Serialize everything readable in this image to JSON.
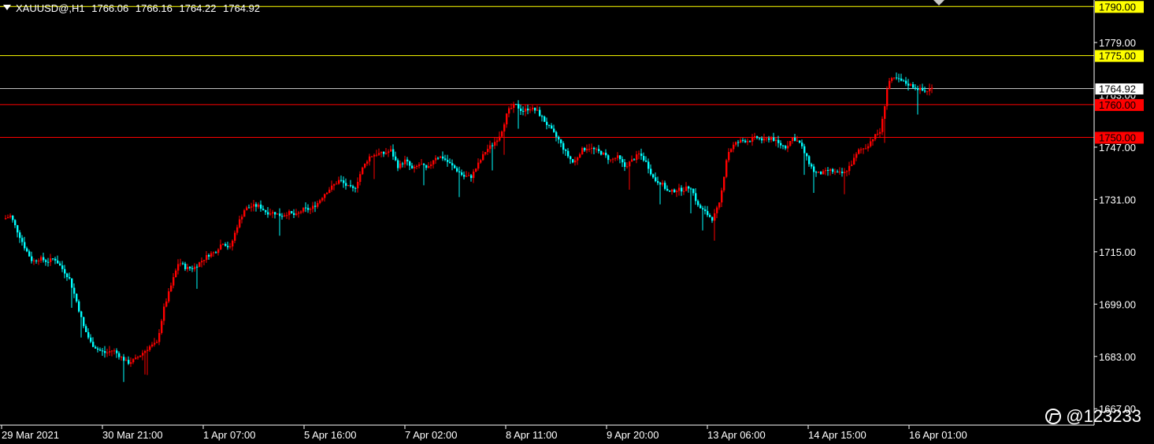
{
  "header": {
    "symbol": "XAUUSD@,H1",
    "open": "1766.06",
    "high": "1766.16",
    "low": "1764.22",
    "close": "1764.92"
  },
  "watermark": "@123233",
  "chart_data": {
    "type": "candlestick",
    "symbol": "XAUUSD@",
    "timeframe": "H1",
    "y_ticks": [
      "1779.00",
      "1763.00",
      "1747.00",
      "1731.00",
      "1715.00",
      "1699.00",
      "1683.00",
      "1667.00"
    ],
    "x_ticks": [
      "29 Mar 2021",
      "30 Mar 21:00",
      "1 Apr 07:00",
      "5 Apr 16:00",
      "7 Apr 02:00",
      "8 Apr 11:00",
      "9 Apr 20:00",
      "13 Apr 06:00",
      "14 Apr 15:00",
      "16 Apr 01:00"
    ],
    "ylim": [
      1662,
      1792
    ],
    "current_price": {
      "label": "1764.92",
      "value": 1764.92,
      "color": "#ffffff"
    },
    "levels": [
      {
        "label": "1790.00",
        "value": 1790,
        "color": "#ffff00",
        "text_color": "#000000"
      },
      {
        "label": "1775.00",
        "value": 1775,
        "color": "#ffff00",
        "text_color": "#000000"
      },
      {
        "label": "1760.00",
        "value": 1760,
        "color": "#ff0000",
        "text_color": "#000000"
      },
      {
        "label": "1750.00",
        "value": 1750,
        "color": "#ff0000",
        "text_color": "#000000"
      }
    ],
    "bull_color": "#ff0000",
    "bear_color": "#00ffff",
    "path_closes": [
      1725,
      1726,
      1721,
      1716,
      1712,
      1713,
      1712,
      1713,
      1710,
      1707,
      1700,
      1692,
      1687,
      1685,
      1684,
      1685,
      1683,
      1681,
      1682,
      1684,
      1686,
      1687,
      1698,
      1705,
      1712,
      1710,
      1710,
      1712,
      1714,
      1715,
      1718,
      1716,
      1723,
      1728,
      1729,
      1729,
      1727,
      1727,
      1726,
      1727,
      1726,
      1728,
      1728,
      1730,
      1733,
      1735,
      1737,
      1735,
      1734,
      1740,
      1744,
      1745,
      1745,
      1746,
      1741,
      1743,
      1740,
      1742,
      1740,
      1744,
      1744,
      1742,
      1740,
      1738,
      1738,
      1742,
      1746,
      1748,
      1751,
      1758,
      1760,
      1758,
      1759,
      1758,
      1755,
      1752,
      1749,
      1745,
      1742,
      1746,
      1747,
      1746,
      1745,
      1743,
      1744,
      1741,
      1743,
      1745,
      1742,
      1737,
      1736,
      1733,
      1734,
      1734,
      1735,
      1729,
      1727,
      1725,
      1730,
      1745,
      1748,
      1749,
      1749,
      1750,
      1749,
      1750,
      1748,
      1747,
      1750,
      1748,
      1743,
      1739,
      1739,
      1740,
      1739,
      1739,
      1742,
      1746,
      1747,
      1750,
      1752,
      1767,
      1768,
      1767,
      1766,
      1765,
      1764,
      1765
    ]
  }
}
